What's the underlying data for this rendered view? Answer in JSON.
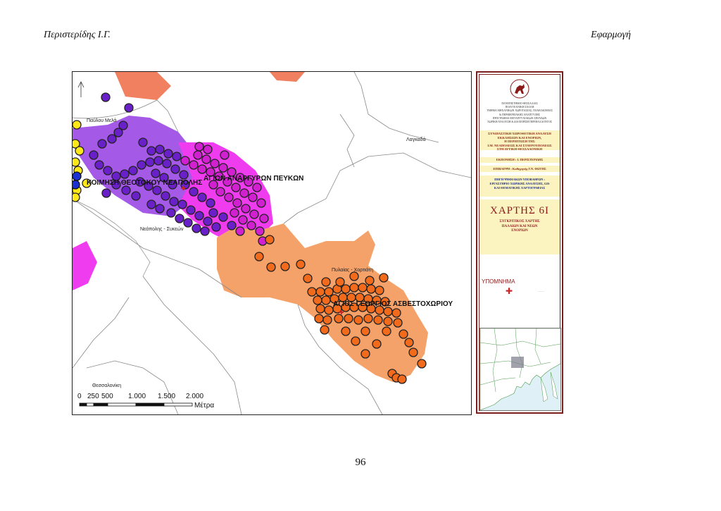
{
  "header": {
    "left": "Περιστερίδης Ι.Γ.",
    "right": "Εφαρμογή"
  },
  "page_number": "96",
  "map": {
    "places": {
      "pavlou_mela": "Παύλου Μελά",
      "lagkadas": "Λαγκαδά",
      "neapolis_sykeon": "Νεάπολης - Συκεών",
      "pylaias_chortiatis": "Πυλαίας - Χορτιάτη",
      "thessaloniki": "Θεσσαλονίκη"
    },
    "parishes": {
      "koimisi": "ΚΟΙΜΗΣΗ ΘΕΟΤΟΚΟΥ ΝΕΑΠΟΛΗΣ",
      "agioi_anargyroi": "ΑΓΙΩΝ ΑΝΑΡΓΥΡΩΝ ΠΕΥΚΩΝ",
      "agios_georgios": "ΑΓΙΟΣ ΓΕΩΡΓΙΟΣ ΑΣΒΕΣΤΟΧΩΡΙΟΥ"
    },
    "scale": {
      "ticks": [
        "0",
        "250",
        "500",
        "1.000",
        "1.500",
        "2.000"
      ],
      "unit": "Μέτρα"
    },
    "colors": {
      "purple": "#6a20c8",
      "magenta": "#d020d0",
      "orange": "#f26a1b",
      "yellow": "#ffe81a",
      "blue": "#1a30d0",
      "orange_area": "#f5a26a",
      "violet_area": "#a45ae6",
      "pink_area": "#ef3cef",
      "salmon_area": "#f08060"
    }
  },
  "panel": {
    "university_lines": [
      "ΠΑΝΕΠΙΣΤΗΜΙΟ ΘΕΣΣΑΛΙΑΣ",
      "ΠΟΛΥΤΕΧΝΙΚΗ ΣΧΟΛΗ",
      "ΤΜΗΜΑ ΜΗΧΑΝΙΚΩΝ ΧΩΡΟΤΑΞΙΑΣ, ΠΟΛΕΟΔΟΜΙΑΣ",
      "& ΠΕΡΙΦΕΡΕΙΑΚΗΣ ΑΝΑΠΤΥΞΗΣ",
      "ΠΡΟΓΡΑΜΜΑ ΜΕΤΑΠΤΥΧΙΑΚΩΝ ΣΠΟΥΔΩΝ",
      "ΧΩΡΙΚΗ ΑΝΑΛΥΣΗ & ΔΙΑΧΕΙΡΙΣΗ ΠΕΡΙΒΑΛΛΟΝΤΟΣ"
    ],
    "title_lines": [
      "ΣΥΝΔΥΑΣΤΙΚΗ ΧΩΡΟΘΕΤΙΚΗ ΑΝΑΛΥΣΗ",
      "ΕΚΚΛΗΣΙΩΝ ΚΑΙ ΕΝΟΡΙΩΝ,",
      "Η ΠΕΡΙΠΤΩΣΗ ΤΗΣ",
      "Ι.Μ. ΝΕΑΠΟΛΕΩΣ ΚΑΙ ΣΤΑΥΡΟΥΠΟΛΕΩΣ",
      "ΣΤΗ ΔΥΤΙΚΗ ΘΕΣΣΑΛΟΝΙΚΗ"
    ],
    "author": "ΕΚΠΟΝΗΣΗ : Ι. ΠΕΡΙΣΤΕΡΙΔΗΣ",
    "supervisor": "ΕΠΙΒΛΕΨΗ : Καθηγητής Γ.Ν. ΦΩΤΗΣ",
    "source_lines": [
      "ΠΗΓΗ ΨΗΦΙΑΚΩΝ ΥΠΟΒΑΘΡΩΝ :",
      "ΕΡΓΑΣΤΗΡΙΟ ΧΩΡΙΚΗΣ ΑΝΑΛΥΣΗΣ, GIS",
      "ΚΑΙ ΘΕΜΑΤΙΚΗΣ ΧΑΡΤΟΓΡΑΦΙΑΣ"
    ],
    "map_number": "ΧΑΡΤΗΣ 6Ι",
    "map_subtitle_lines": [
      "ΣΥΓΚΡΙΤΙΚΟΣ ΧΑΡΤΗΣ",
      "ΠΑΛΑΙΩΝ ΚΑΙ ΝΕΩΝ",
      "ΕΝΟΡΙΩΝ"
    ],
    "legend_title": "ΥΠΟΜΝΗΜΑ"
  }
}
